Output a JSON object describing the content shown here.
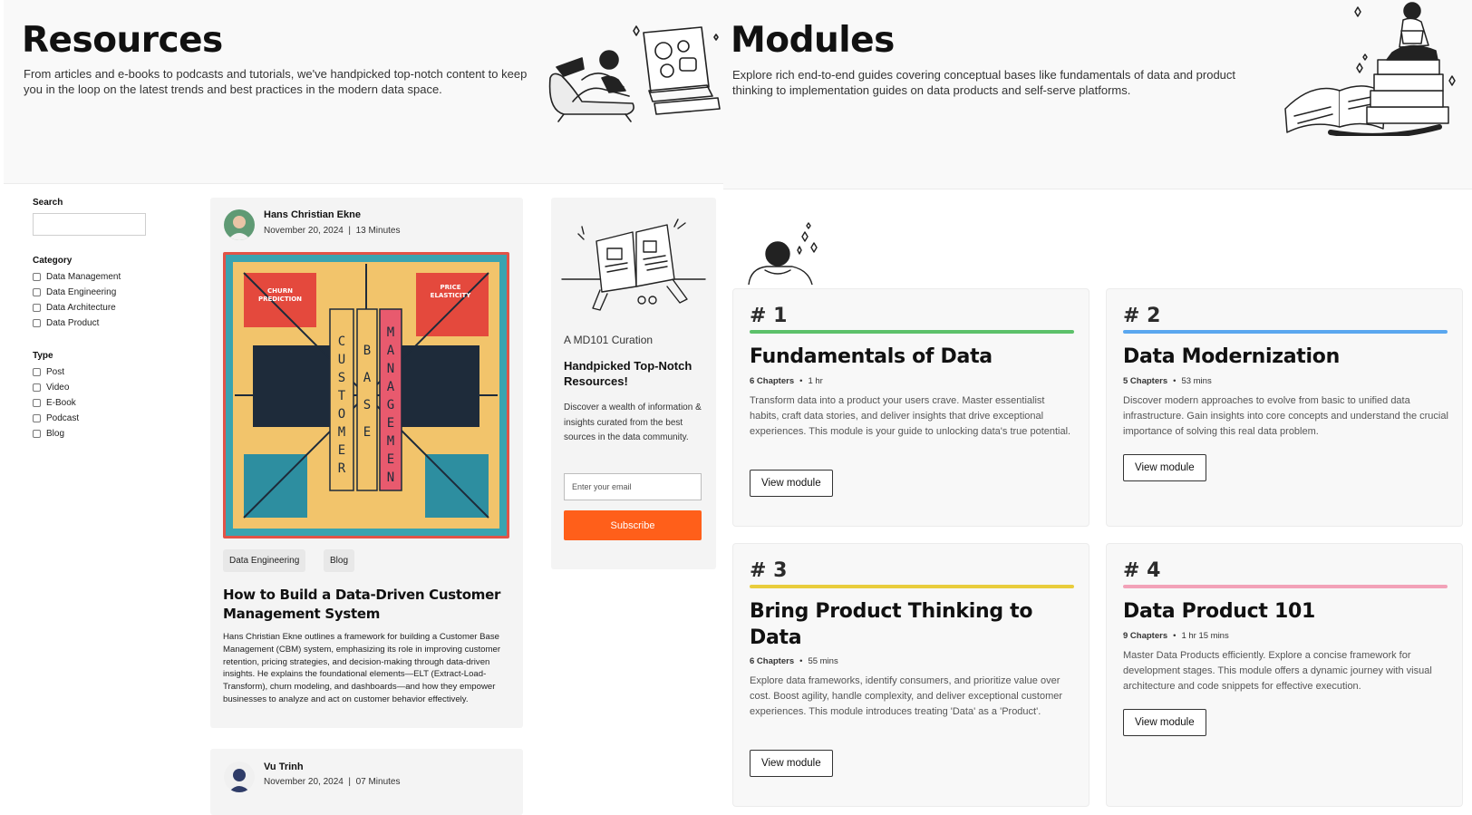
{
  "resources": {
    "title": "Resources",
    "description": "From articles and e-books to podcasts and tutorials, we've handpicked top-notch content to keep you in the loop on the latest trends and best practices in the modern data space.",
    "filters": {
      "search_label": "Search",
      "search_value": "",
      "category_label": "Category",
      "categories": [
        "Data Management",
        "Data Engineering",
        "Data Architecture",
        "Data Product"
      ],
      "type_label": "Type",
      "types": [
        "Post",
        "Video",
        "E-Book",
        "Podcast",
        "Blog"
      ]
    },
    "posts": [
      {
        "author": "Hans Christian Ekne",
        "date": "November 20, 2024",
        "read_time": "13 Minutes",
        "cover_lettering": [
          "CHURN PREDICTION",
          "PRICE ELASTICITY",
          "CUSTOMER",
          "BASE",
          "MANAGEMENT"
        ],
        "tags": [
          "Data Engineering",
          "Blog"
        ],
        "title": "How to Build a Data-Driven Customer Management System",
        "excerpt": "Hans Christian Ekne outlines a framework for building a Customer Base Management (CBM) system, emphasizing its role in improving customer retention, pricing strategies, and decision-making through data-driven insights. He explains the foundational elements—ELT (Extract-Load-Transform), churn modeling, and dashboards—and how they empower businesses to analyze and act on customer behavior effectively."
      },
      {
        "author": "Vu Trinh",
        "date": "November 20, 2024",
        "read_time": "07 Minutes"
      }
    ],
    "curation": {
      "kicker": "A MD101 Curation",
      "title": "Handpicked Top-Notch Resources!",
      "description": "Discover a wealth of information & insights curated from the best sources in the data community.",
      "email_placeholder": "Enter your email",
      "subscribe_label": "Subscribe",
      "subscribe_color": "#ff5f1a"
    }
  },
  "modules": {
    "title": "Modules",
    "description": "Explore rich end-to-end guides covering conceptual bases like fundamentals of data and product thinking to implementation guides on data products and self-serve platforms.",
    "items": [
      {
        "number": "# 1",
        "accent": "#5cc16a",
        "title": "Fundamentals of Data",
        "chapters": "6 Chapters",
        "duration": "1 hr",
        "description": "Transform data into a product your users crave. Master essentialist habits, craft data stories, and deliver insights that drive exceptional experiences. This module is your guide to unlocking data's true potential.",
        "button": "View module"
      },
      {
        "number": "# 2",
        "accent": "#5aa7ef",
        "title": "Data Modernization",
        "chapters": "5 Chapters",
        "duration": "53 mins",
        "description": "Discover modern approaches to evolve from basic to unified data infrastructure. Gain insights into core concepts and understand the crucial importance of solving this real data problem.",
        "button": "View module"
      },
      {
        "number": "# 3",
        "accent": "#e9cd3c",
        "title": "Bring Product Thinking to Data",
        "chapters": "6 Chapters",
        "duration": "55 mins",
        "description": "Explore data frameworks, identify consumers, and prioritize value over cost. Boost agility, handle complexity, and deliver exceptional customer experiences. This module introduces treating 'Data' as a 'Product'.",
        "button": "View module"
      },
      {
        "number": "# 4",
        "accent": "#f2a2b8",
        "title": "Data Product 101",
        "chapters": "9 Chapters",
        "duration": "1 hr 15 mins",
        "description": "Master Data Products efficiently. Explore a concise framework for development stages. This module offers a dynamic journey with visual architecture and code snippets for effective execution.",
        "button": "View module"
      }
    ]
  }
}
